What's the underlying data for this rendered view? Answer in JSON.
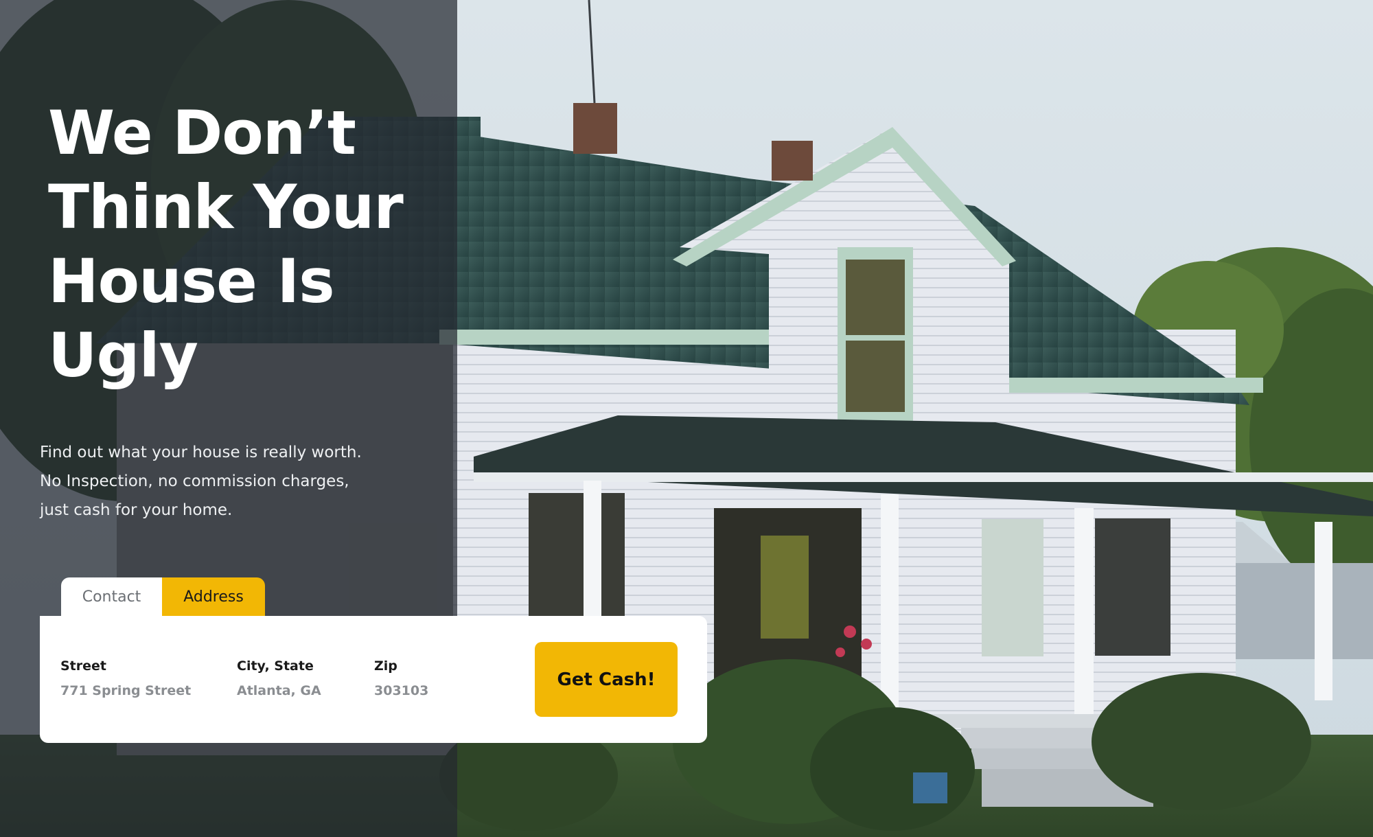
{
  "hero": {
    "headline_lines": [
      "We Don’t",
      "Think Your",
      "House Is",
      "Ugly"
    ],
    "subcopy_lines": [
      "Find out what your house is really worth.",
      "No Inspection, no commission charges,",
      "just cash for your home."
    ]
  },
  "tabs": [
    {
      "label": "Contact",
      "active": false
    },
    {
      "label": "Address",
      "active": true
    }
  ],
  "form": {
    "street": {
      "label": "Street",
      "value": "771 Spring Street"
    },
    "city_state": {
      "label": "City, State",
      "value": "Atlanta, GA"
    },
    "zip": {
      "label": "Zip",
      "value": "303103"
    },
    "submit_label": "Get Cash!"
  },
  "colors": {
    "accent": "#f2b705",
    "panel_overlay": "#242830",
    "card": "#ffffff",
    "label_text": "#1a1a1a",
    "value_text": "#8a8d91"
  },
  "background_image": "photo of white farmhouse with green metal roof and front porch"
}
